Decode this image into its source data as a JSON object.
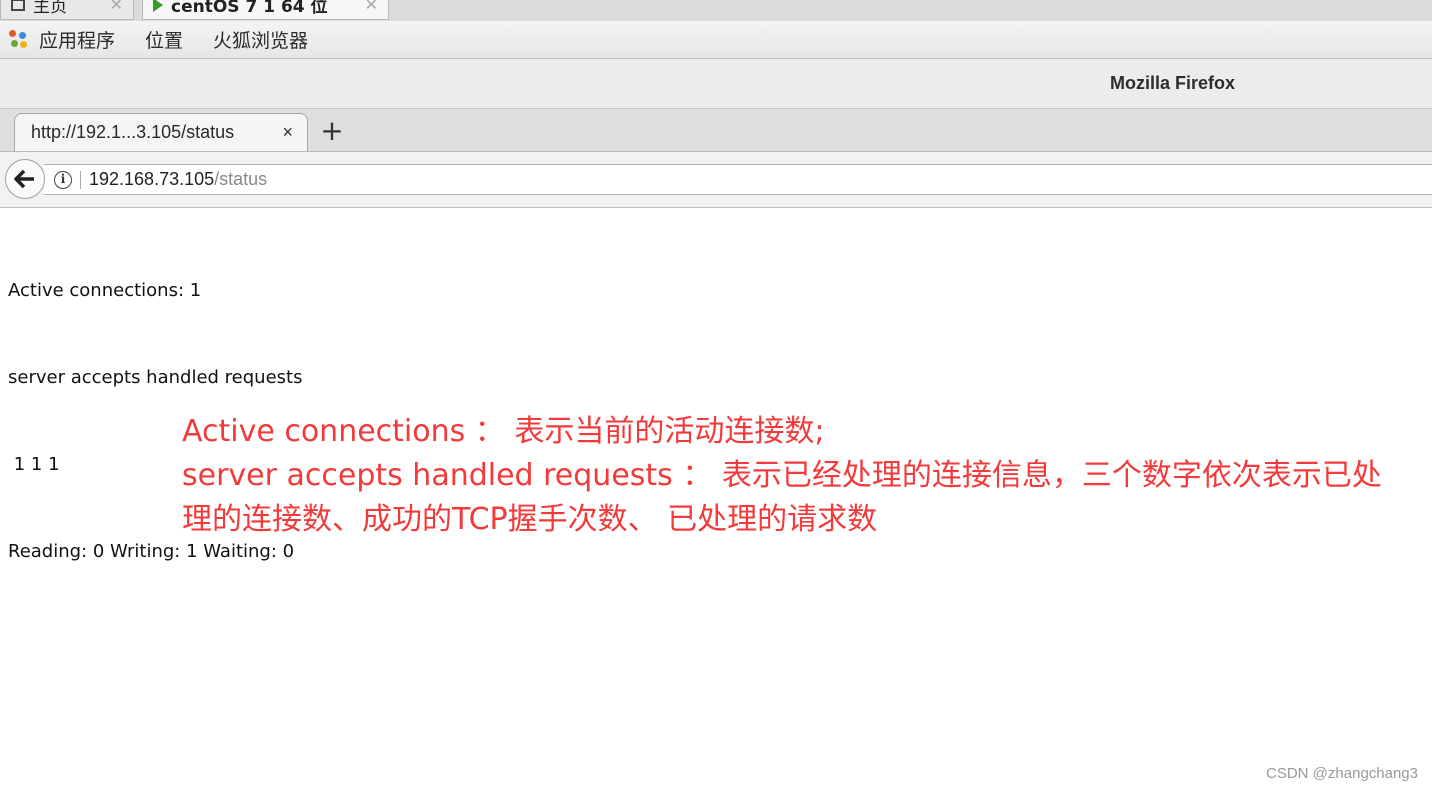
{
  "host_tabs": {
    "home_label": "主页",
    "vm_label": "centOS 7 1 64 位"
  },
  "gnome_bar": {
    "items": [
      "应用程序",
      "位置",
      "火狐浏览器"
    ]
  },
  "window": {
    "title": "Mozilla Firefox"
  },
  "browser": {
    "tab_title": "http://192.1...3.105/status",
    "tab_close": "×",
    "new_tab": "+",
    "url_host": "192.168.73.105",
    "url_path": "/status"
  },
  "page": {
    "lines": [
      "Active connections: 1",
      "server accepts handled requests",
      " 1 1 1",
      "Reading: 0 Writing: 1 Waiting: 0"
    ]
  },
  "annotation": {
    "color": "#f23a3a",
    "lines": [
      "Active connections ： 表示当前的活动连接数;",
      "server accepts handled requests ： 表示已经处理的连接信息，三个数字依次表示已处",
      "理的连接数、成功的TCP握手次数、 已处理的请求数"
    ]
  },
  "watermark": "CSDN @zhangchang3"
}
